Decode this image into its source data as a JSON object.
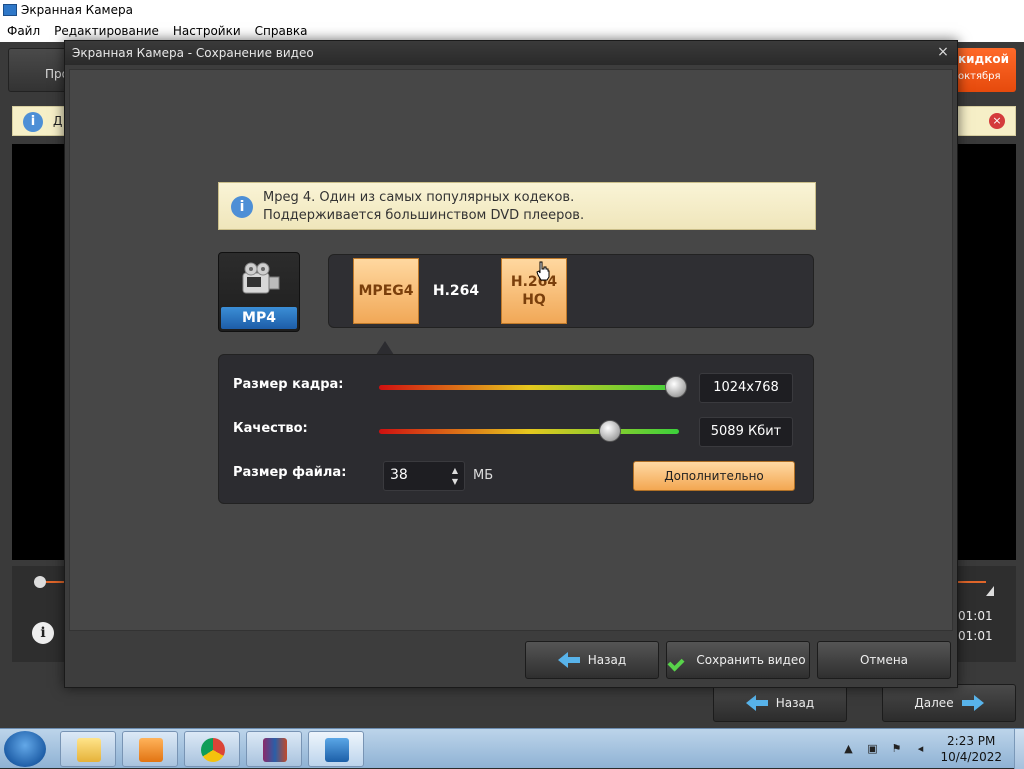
{
  "app": {
    "title": "Экранная Камера",
    "menu": [
      "Файл",
      "Редактирование",
      "Настройки",
      "Справка"
    ],
    "left_button_label": "Про",
    "promo": {
      "line1": "кидкой",
      "line2": "октября"
    },
    "info_text": "Д",
    "time_1": "01:01",
    "time_2": "01:01",
    "back_label": "Назад",
    "next_label": "Далее"
  },
  "dialog": {
    "title": "Экранная Камера - Сохранение видео",
    "close_glyph": "×",
    "info": {
      "line1": "Mpeg 4. Один из самых популярных кодеков.",
      "line2": "Поддерживается большинством DVD плееров."
    },
    "format_label": "MP4",
    "codecs": [
      {
        "label": "MPEG4",
        "active": true
      },
      {
        "label": "H.264",
        "active": false
      },
      {
        "label": "H.264 HQ",
        "active": true
      }
    ],
    "settings": {
      "frame_size_label": "Размер кадра:",
      "frame_size_value": "1024x768",
      "frame_size_level": 0.99,
      "quality_label": "Качество:",
      "quality_value": "5089 Кбит",
      "quality_level": 0.77,
      "file_size_label": "Размер файла:",
      "file_size_value": "38",
      "file_size_unit": "МБ",
      "advanced_label": "Дополнительно"
    },
    "buttons": {
      "back": "Назад",
      "save": "Сохранить видео",
      "cancel": "Отмена"
    }
  },
  "taskbar": {
    "time": "2:23 PM",
    "date": "10/4/2022"
  },
  "colors": {
    "accent_orange": "#f1a857",
    "info_blue": "#4d8fd6",
    "arrow_blue": "#58b3ea",
    "check_green": "#58d34a"
  }
}
